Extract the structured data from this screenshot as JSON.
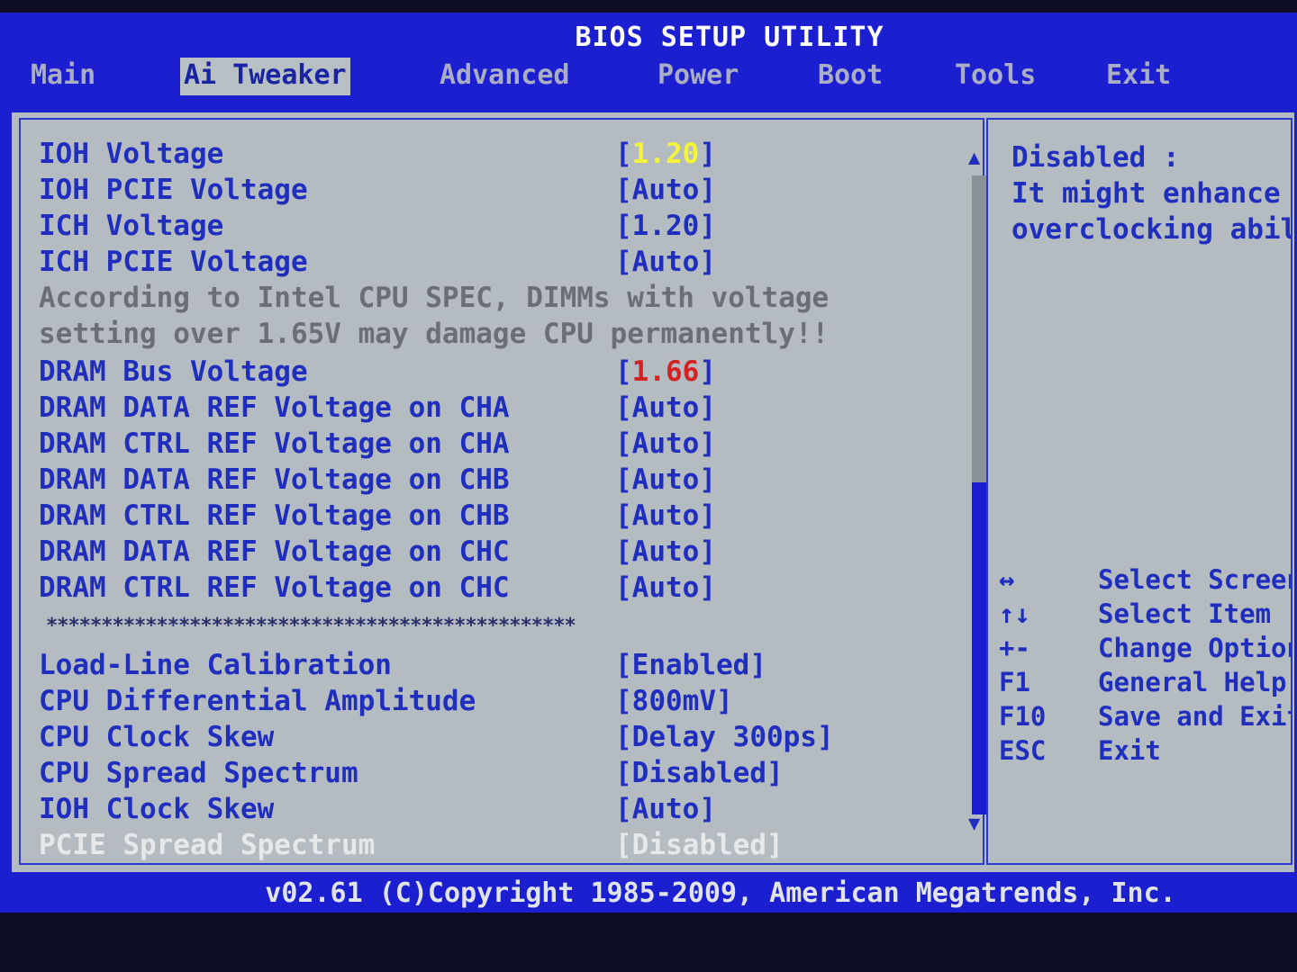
{
  "title": "BIOS SETUP UTILITY",
  "tabs": [
    {
      "label": "Main"
    },
    {
      "label": "Ai Tweaker"
    },
    {
      "label": "Advanced"
    },
    {
      "label": "Power"
    },
    {
      "label": "Boot"
    },
    {
      "label": "Tools"
    },
    {
      "label": "Exit"
    }
  ],
  "settings_top": [
    {
      "label": "IOH Voltage",
      "value_prefix": "[",
      "value": "1.20",
      "value_suffix": "]"
    },
    {
      "label": "IOH PCIE Voltage",
      "value_prefix": "[",
      "value": "Auto",
      "value_suffix": "]"
    },
    {
      "label": "ICH Voltage",
      "value_prefix": "[",
      "value": "1.20",
      "value_suffix": "]"
    },
    {
      "label": "ICH PCIE Voltage",
      "value_prefix": "[",
      "value": "Auto",
      "value_suffix": "]"
    }
  ],
  "warning": [
    "According to Intel CPU SPEC, DIMMs with voltage",
    "setting over 1.65V may damage CPU permanently!!"
  ],
  "settings_dram": [
    {
      "label": "DRAM Bus Voltage",
      "value_prefix": "[",
      "value": "1.66",
      "value_suffix": "]"
    },
    {
      "label": "DRAM DATA REF Voltage on CHA",
      "value_prefix": "[",
      "value": "Auto",
      "value_suffix": "]"
    },
    {
      "label": "DRAM CTRL REF Voltage on CHA",
      "value_prefix": "[",
      "value": "Auto",
      "value_suffix": "]"
    },
    {
      "label": "DRAM DATA REF Voltage on CHB",
      "value_prefix": "[",
      "value": "Auto",
      "value_suffix": "]"
    },
    {
      "label": "DRAM CTRL REF Voltage on CHB",
      "value_prefix": "[",
      "value": "Auto",
      "value_suffix": "]"
    },
    {
      "label": "DRAM DATA REF Voltage on CHC",
      "value_prefix": "[",
      "value": "Auto",
      "value_suffix": "]"
    },
    {
      "label": "DRAM CTRL REF Voltage on CHC",
      "value_prefix": "[",
      "value": "Auto",
      "value_suffix": "]"
    }
  ],
  "divider": "************************************************",
  "settings_bottom": [
    {
      "label": "Load-Line Calibration",
      "value_prefix": "[",
      "value": "Enabled",
      "value_suffix": "]"
    },
    {
      "label": "CPU Differential Amplitude",
      "value_prefix": "[",
      "value": "800mV",
      "value_suffix": "]"
    },
    {
      "label": "CPU Clock Skew",
      "value_prefix": "[",
      "value": "Delay 300ps",
      "value_suffix": "]"
    },
    {
      "label": "CPU Spread Spectrum",
      "value_prefix": "[",
      "value": "Disabled",
      "value_suffix": "]"
    },
    {
      "label": "IOH Clock Skew",
      "value_prefix": "[",
      "value": "Auto",
      "value_suffix": "]"
    },
    {
      "label": "PCIE Spread Spectrum",
      "value_prefix": "[",
      "value": "Disabled",
      "value_suffix": "]"
    }
  ],
  "scrollbar": {
    "up_glyph": "▲",
    "down_glyph": "▼",
    "position_fraction": 0.48,
    "visible_fraction": 0.52
  },
  "help": {
    "lines": [
      "Disabled :",
      "It might enhance B",
      "overclocking abili"
    ]
  },
  "keys": [
    {
      "key": "↔",
      "desc": "Select Screen"
    },
    {
      "key": "↑↓",
      "desc": "Select Item"
    },
    {
      "key": "+-",
      "desc": "Change Option"
    },
    {
      "key": "F1",
      "desc": "General Help"
    },
    {
      "key": "F10",
      "desc": "Save and Exit"
    },
    {
      "key": "ESC",
      "desc": "Exit"
    }
  ],
  "footer": "v02.61 (C)Copyright 1985-2009, American Megatrends, Inc.",
  "colors": {
    "background": "#1b1fd0",
    "panel": "#b4bcc2",
    "text": "#1f2ebd",
    "highlight_yellow": "#f4f43a",
    "warning_red": "#d22222"
  }
}
